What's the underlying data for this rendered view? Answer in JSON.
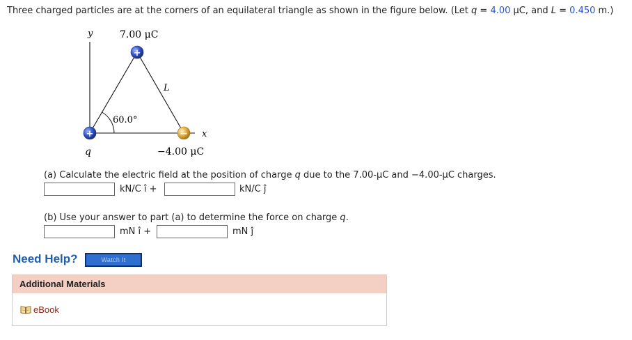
{
  "problem": {
    "prefix": "Three charged particles are at the corners of an equilateral triangle as shown in the figure below. (Let ",
    "q_symbol": "q",
    "eq1": " = ",
    "q_value": "4.00",
    "q_unit": " μC, and ",
    "L_symbol": "L",
    "eq2": " = ",
    "L_value": "0.450",
    "suffix": " m.)"
  },
  "figure": {
    "y_label": "y",
    "x_label": "x",
    "top_charge": "7.00 μC",
    "right_charge": "−4.00 μC",
    "left_charge": "q",
    "side_label": "L",
    "angle_label": "60.0°",
    "plus_sign": "+",
    "minus_sign": "−"
  },
  "part_a": {
    "text_before": "(a) Calculate the electric field at the position of charge ",
    "q_symbol": "q",
    "text_after": " due to the 7.00-μC and −4.00-μC charges.",
    "unit_i": "kN/C î +",
    "unit_j": "kN/C ĵ",
    "input_i_value": "",
    "input_j_value": ""
  },
  "part_b": {
    "text_before": "(b) Use your answer to part (a) to determine the force on charge ",
    "q_symbol": "q",
    "text_after": ".",
    "unit_i": "mN î +",
    "unit_j": "mN ĵ",
    "input_i_value": "",
    "input_j_value": ""
  },
  "help": {
    "need_help": "Need Help?",
    "watch_it": "Watch It"
  },
  "materials": {
    "header": "Additional Materials",
    "ebook": "eBook"
  },
  "colors": {
    "value_blue": "#2554c7",
    "link_blue": "#1f5fad",
    "header_bg": "#f4d0c4",
    "positive_charge": "#3a58c9",
    "negative_charge": "#d9a53a"
  }
}
